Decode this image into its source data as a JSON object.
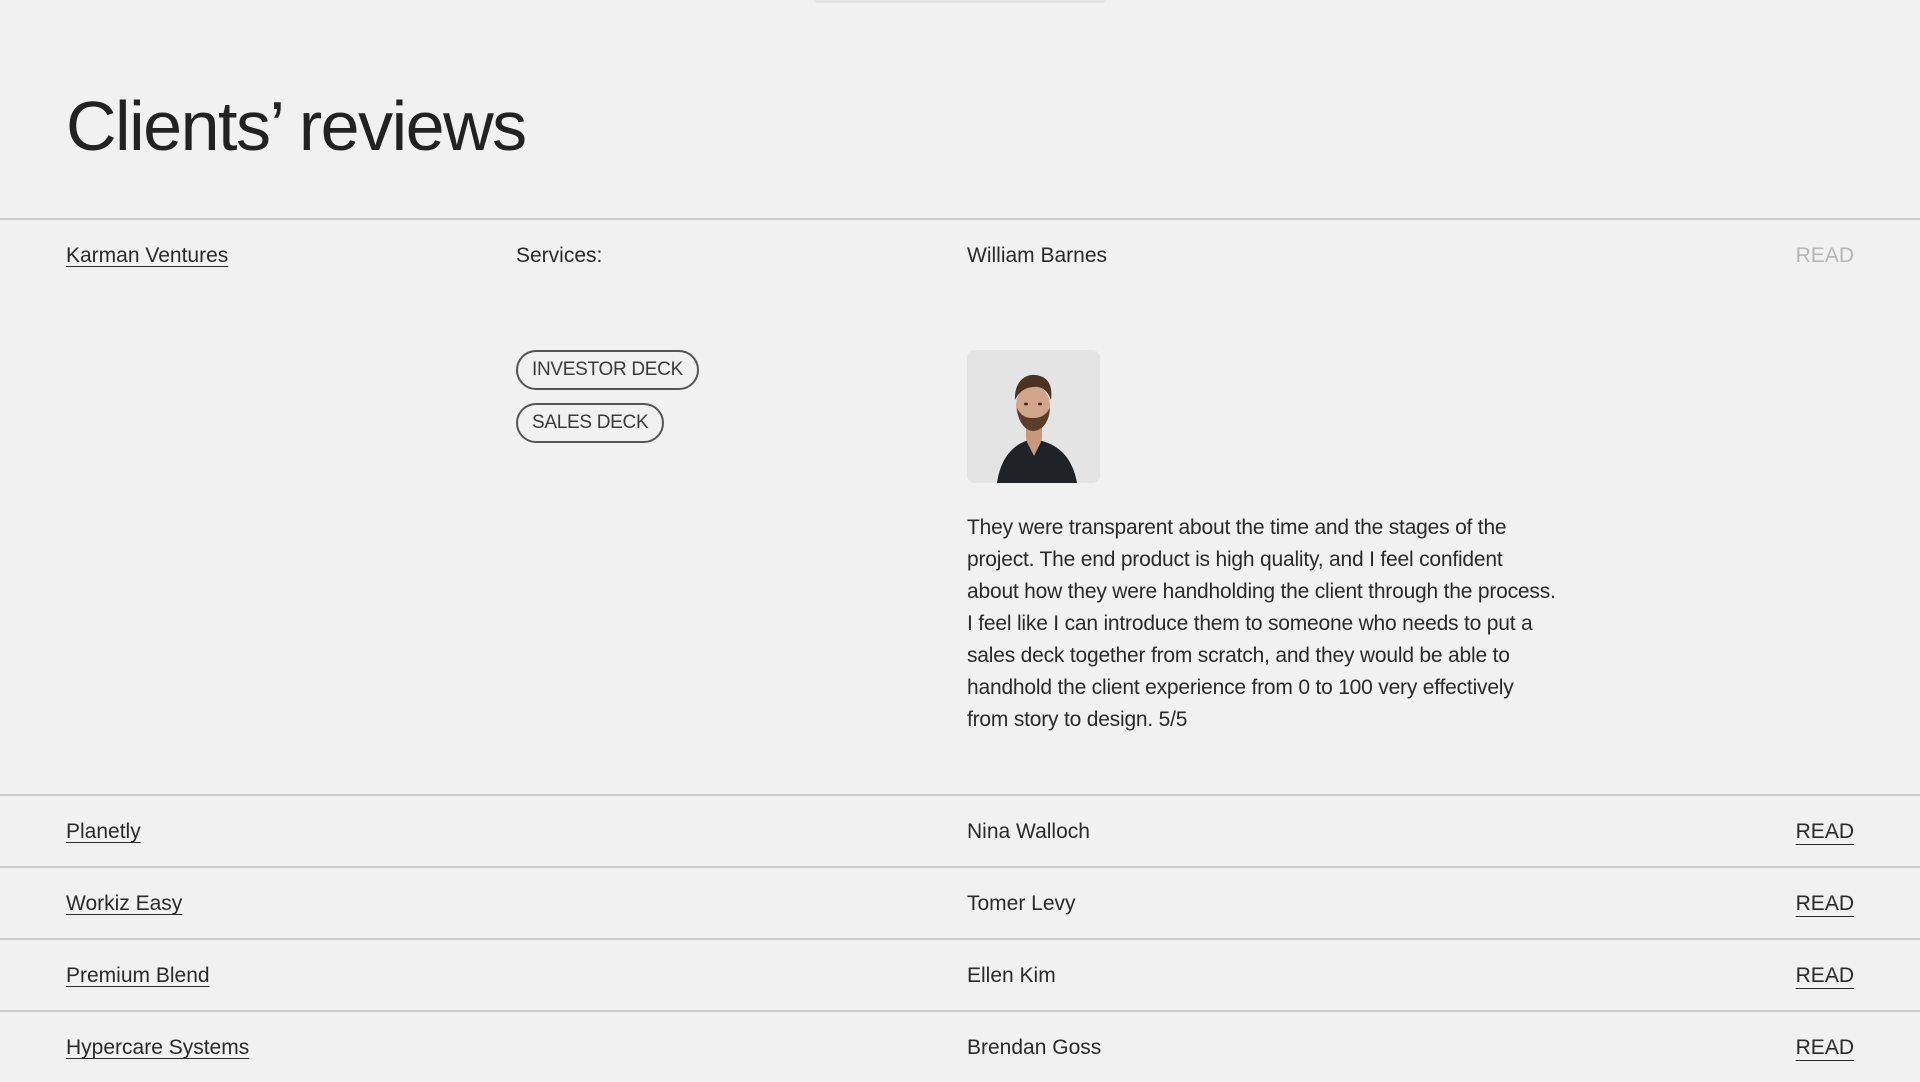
{
  "page": {
    "title": "Clients’ reviews"
  },
  "reviews": [
    {
      "company": "Karman Ventures",
      "services_label": "Services:",
      "services": [
        "INVESTOR DECK",
        "SALES DECK"
      ],
      "person": "William Barnes",
      "read_label": "READ",
      "quote": "They were transparent about the time and the stages of the project. The end product is high quality, and I feel confident about how they were handholding the client through the process. I feel like I can introduce them to someone who needs to put a sales deck together from scratch, and they would be able to handhold the client experience from 0 to 100 very effectively from story to design. 5/5",
      "expanded": true
    },
    {
      "company": "Planetly",
      "person": "Nina Walloch",
      "read_label": "READ",
      "expanded": false
    },
    {
      "company": "Workiz Easy",
      "person": "Tomer Levy",
      "read_label": "READ",
      "expanded": false
    },
    {
      "company": "Premium Blend",
      "person": "Ellen Kim",
      "read_label": "READ",
      "expanded": false
    },
    {
      "company": "Hypercare Systems",
      "person": "Brendan Goss",
      "read_label": "READ",
      "expanded": false
    }
  ],
  "colors": {
    "background": "#f1f1f1",
    "text": "#2a2a2a",
    "muted": "#b7b7b7",
    "divider": "#c9c9c9"
  }
}
